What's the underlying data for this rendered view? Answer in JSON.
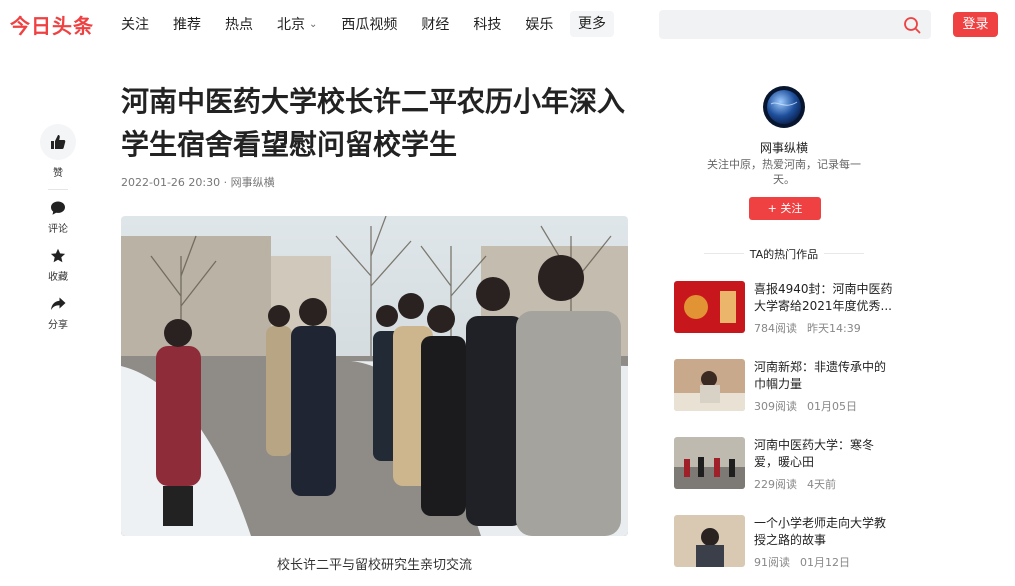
{
  "header": {
    "logo": "今日头条",
    "nav": [
      {
        "label": "关注"
      },
      {
        "label": "推荐"
      },
      {
        "label": "热点"
      },
      {
        "label": "北京"
      },
      {
        "label": "西瓜视频"
      },
      {
        "label": "财经"
      },
      {
        "label": "科技"
      },
      {
        "label": "娱乐"
      }
    ],
    "more_label": "更多",
    "search_placeholder": "",
    "login_label": "登录",
    "accent": "#f04142"
  },
  "rail": {
    "like_label": "赞",
    "comment_label": "评论",
    "favorite_label": "收藏",
    "share_label": "分享"
  },
  "article": {
    "title": "河南中医药大学校长许二平农历小年深入学生宿舍看望慰问留校学生",
    "meta": "2022-01-26 20:30 · 网事纵横",
    "caption": "校长许二平与留校研究生亲切交流"
  },
  "author": {
    "name": "网事纵横",
    "bio": "关注中原，热爱河南，记录每一天。",
    "follow_label": "+ 关注",
    "hot_header": "TA的热门作品"
  },
  "hot_works": [
    {
      "title": "喜报4940封：河南中医药大学寄给2021年度优秀...",
      "reads": "784阅读",
      "time": "昨天14:39"
    },
    {
      "title": "河南新郑：非遗传承中的巾帼力量",
      "reads": "309阅读",
      "time": "01月05日"
    },
    {
      "title": "河南中医药大学：寒冬爱，暖心田",
      "reads": "229阅读",
      "time": "4天前"
    },
    {
      "title": "一个小学老师走向大学教授之路的故事",
      "reads": "91阅读",
      "time": "01月12日"
    }
  ]
}
